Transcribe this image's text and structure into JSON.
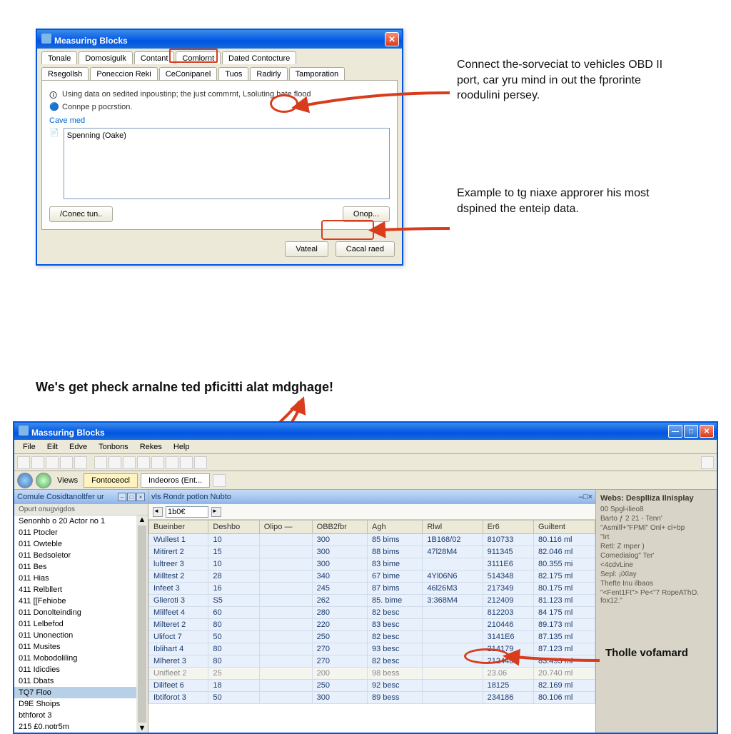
{
  "colors": {
    "accent": "#0054e3",
    "annotation": "#d93c1c",
    "panel": "#ece9d8"
  },
  "dialog": {
    "title": "Measuring Blocks",
    "tabs_row1": [
      "Tonale",
      "Domosigulk",
      "Contant",
      "Comlornt",
      "Dated Contocture"
    ],
    "tabs_row1_highlighted_index": 3,
    "tabs_row2": [
      "Rsegollsh",
      "Poneccion Reki",
      "CeConipanel",
      "Tuos",
      "Radirly",
      "Tamporation"
    ],
    "tabs_row2_selected_index": 1,
    "info1": "Using data on sedited inpoustinp; the just commrnt, Lsoluting hate flood",
    "info2": "Connpe p pocrstion.",
    "link_text": "Cave med",
    "textbox_value": "Spenning (Oake)",
    "btn_connect": "/Conec tun..",
    "btn_options": "Onop...",
    "btn_apply": "Vateal",
    "btn_cancel": "Cacal raed"
  },
  "annotations": {
    "a1": "Connect the-sorveciat to vehicles OBD II port, car yru mind in out the fprorinte roodulini persey.",
    "a2": "Example to tg niaxe approrer his most dspined the enteip data.",
    "a3": "We's get pheck arnalne ted pficitti alat mdghage!",
    "a4": "Tholle vofamard"
  },
  "app": {
    "title": "Massuring Blocks",
    "menus": [
      "File",
      "Eilt",
      "Edve",
      "Tonbons",
      "Rekes",
      "Help"
    ],
    "address_label1": "Views",
    "address_tab1": "Fontoceocl",
    "address_tab2": "Indeoros (Ent...",
    "left_pane_title": "Comule Cosidtanoltfer  ur",
    "left_sub_header": "Opurt onugvigdos",
    "tree_items": [
      "Senonhb o 20 Actor no 1",
      "011 Ptocler",
      "011 Owteble",
      "011 Bedsoletor",
      "011 Bes",
      "011 Hias",
      "411 Relbllert",
      "411 [[Fehiobe",
      "011 Donolteinding",
      "011 Lelbefod",
      "011 Unonection",
      "011 Musites",
      "011 Mobodoliling",
      "011 Idicdies",
      "011 Dbats",
      "TQ7 Floo",
      "D9E Shoips",
      "bthforot 3",
      "215 £0.notr5m"
    ],
    "tree_selected_index": 15,
    "center_title": "vls Rondr potlon Nubto",
    "stepper_value": "1b0€",
    "grid_headers": [
      "Bueinber",
      "Deshbo",
      "Olipo —",
      "OBB2fbr",
      "Agh",
      "Rlwl",
      "Er6",
      "Guiltent"
    ],
    "grid_rows": [
      [
        "Wullest 1",
        "10",
        "",
        "300",
        "85 bims",
        "1B168/02",
        "810733",
        "80.116 ml"
      ],
      [
        "Mitirert 2",
        "15",
        "",
        "300",
        "88 bims",
        "47l28M4",
        "911345",
        "82.046 ml"
      ],
      [
        "lultreer 3",
        "10",
        "",
        "300",
        "83 bime",
        "",
        "3111E6",
        "80.355 mi"
      ],
      [
        "Milltest 2",
        "28",
        "",
        "340",
        "67 bime",
        "4Yl06N6",
        "514348",
        "82.175 ml"
      ],
      [
        "Infeet 3",
        "16",
        "",
        "245",
        "87 bims",
        "46l26M3",
        "217349",
        "80.175 ml"
      ],
      [
        "Glieroti 3",
        "S5",
        "",
        "262",
        "85. bime",
        "3:368M4",
        "212409",
        "81.123 ml"
      ],
      [
        "Mlilfeet 4",
        "60",
        "",
        "280",
        "82 besc",
        "",
        "812203",
        "84 175 ml"
      ],
      [
        "Milteret 2",
        "80",
        "",
        "220",
        "83 besc",
        "",
        "210446",
        "89.173 ml"
      ],
      [
        "Ulifoct 7",
        "50",
        "",
        "250",
        "82 besc",
        "",
        "3141E6",
        "87.135 ml"
      ],
      [
        "Iblihart 4",
        "80",
        "",
        "270",
        "93 besc",
        "",
        "214179",
        "87.123 ml"
      ],
      [
        "Mlheret 3",
        "80",
        "",
        "270",
        "82 besc",
        "",
        "212448",
        "83.493 ml"
      ],
      [
        "Unifleet 2",
        "25",
        "",
        "200",
        "98 bess",
        "",
        "23.06",
        "20.740 ml"
      ],
      [
        "Dilifeet 6",
        "18",
        "",
        "250",
        "92 besc",
        "",
        "18125",
        "82.169 ml"
      ],
      [
        "Ibtiforot 3",
        "50",
        "",
        "300",
        "89 bess",
        "",
        "234186",
        "80.106 ml"
      ]
    ],
    "grid_dim_row_index": 11,
    "right_pane": {
      "title": "Webs:  Desplliza Ilnisplay",
      "lines": [
        "00 Spgl-ilieo8",
        "Barto  ƒ  2  21  -  Tenn'",
        "\"Asmilf+\"FPMl\" Onl+ cl+bp",
        "\"Irt",
        "Retl:  Z rnper )",
        "Comedialog\"  Ter'",
        "<4cdvLine",
        "Sepl: ¡iXlay",
        "Thefte  Inu  ilbaos",
        "\"<Fent1Ft\"> Pe<\"7  RopeAThO.  fox12.\""
      ]
    }
  }
}
